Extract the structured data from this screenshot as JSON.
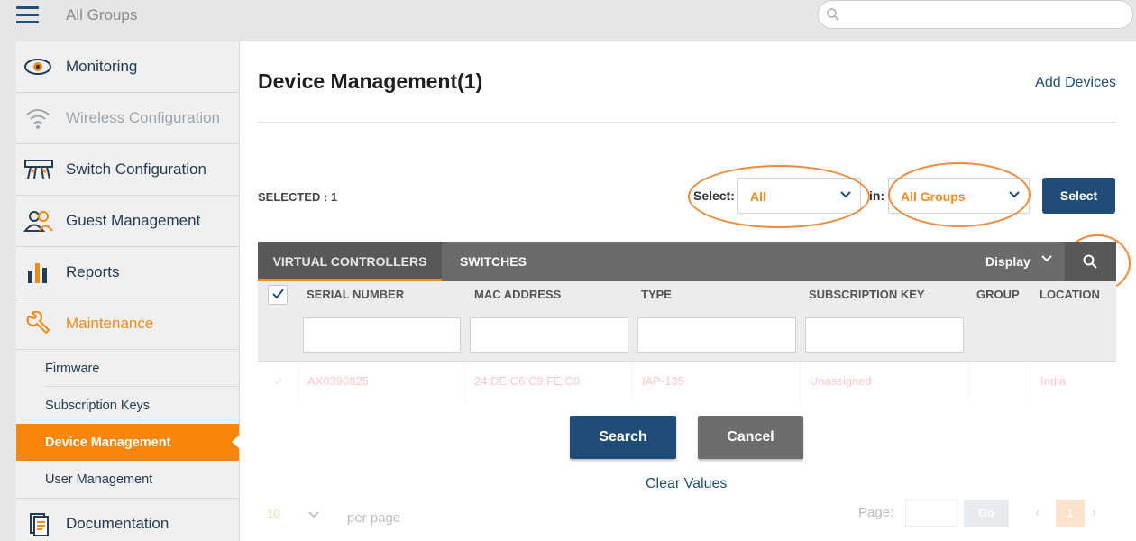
{
  "header": {
    "group_title": "All Groups",
    "search_placeholder": ""
  },
  "sidebar": {
    "items": [
      {
        "label": "Monitoring"
      },
      {
        "label": "Wireless Configuration"
      },
      {
        "label": "Switch Configuration"
      },
      {
        "label": "Guest Management"
      },
      {
        "label": "Reports"
      },
      {
        "label": "Maintenance"
      },
      {
        "label": "Documentation"
      }
    ],
    "sub_items": [
      {
        "label": "Firmware"
      },
      {
        "label": "Subscription Keys"
      },
      {
        "label": "Device Management"
      },
      {
        "label": "User Management"
      }
    ]
  },
  "main": {
    "title": "Device Management(1)",
    "add_devices": "Add Devices",
    "selected_label": "SELECTED : 1",
    "select_label": "Select:",
    "select_value": "All",
    "in_label": "in:",
    "group_value": "All Groups",
    "select_button": "Select",
    "tabs": [
      {
        "label": "VIRTUAL CONTROLLERS"
      },
      {
        "label": "SWITCHES"
      }
    ],
    "display_label": "Display",
    "columns": [
      "SERIAL NUMBER",
      "MAC ADDRESS",
      "TYPE",
      "SUBSCRIPTION KEY",
      "GROUP",
      "LOCATION"
    ],
    "ghost_row": [
      "AX0390825",
      "24:DE:C6:C9:FE:C0",
      "IAP-135",
      "Unassigned",
      "",
      "India"
    ],
    "search_button": "Search",
    "cancel_button": "Cancel",
    "clear_values": "Clear Values"
  },
  "pagination": {
    "per_page_value": "10",
    "per_page_label": "per page",
    "page_label": "Page:",
    "go_label": "Go",
    "current_page": "1"
  },
  "colors": {
    "accent": "#f7860b",
    "primary": "#1f4d78",
    "annotation": "#ef8a3c"
  }
}
